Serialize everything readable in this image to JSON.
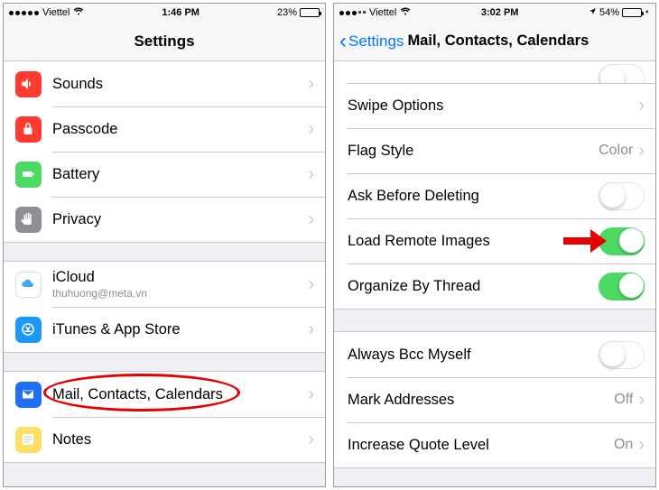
{
  "left": {
    "status": {
      "carrier": "Viettel",
      "time": "1:46 PM",
      "battery_pct": "23%"
    },
    "title": "Settings",
    "groups": [
      {
        "rows": [
          {
            "key": "sounds",
            "label": "Sounds"
          },
          {
            "key": "passcode",
            "label": "Passcode"
          },
          {
            "key": "battery",
            "label": "Battery"
          },
          {
            "key": "privacy",
            "label": "Privacy"
          }
        ]
      },
      {
        "rows": [
          {
            "key": "icloud",
            "label": "iCloud",
            "sublabel": "thuhuong@meta.vn"
          },
          {
            "key": "itunes",
            "label": "iTunes & App Store"
          }
        ]
      },
      {
        "rows": [
          {
            "key": "mail",
            "label": "Mail, Contacts, Calendars"
          },
          {
            "key": "notes",
            "label": "Notes"
          }
        ]
      }
    ]
  },
  "right": {
    "status": {
      "carrier": "Viettel",
      "time": "3:02 PM",
      "battery_pct": "54%"
    },
    "back": "Settings",
    "title": "Mail, Contacts, Calendars",
    "rows": [
      {
        "key": "swipe",
        "label": "Swipe Options",
        "type": "disclosure"
      },
      {
        "key": "flag",
        "label": "Flag Style",
        "type": "disclosure",
        "detail": "Color"
      },
      {
        "key": "askdel",
        "label": "Ask Before Deleting",
        "type": "switch",
        "on": false
      },
      {
        "key": "loadimg",
        "label": "Load Remote Images",
        "type": "switch",
        "on": true,
        "highlighted": true
      },
      {
        "key": "thread",
        "label": "Organize By Thread",
        "type": "switch",
        "on": true
      }
    ],
    "rows2": [
      {
        "key": "bcc",
        "label": "Always Bcc Myself",
        "type": "switch",
        "on": false
      },
      {
        "key": "markaddr",
        "label": "Mark Addresses",
        "type": "disclosure",
        "detail": "Off"
      },
      {
        "key": "quote",
        "label": "Increase Quote Level",
        "type": "disclosure",
        "detail": "On"
      }
    ]
  }
}
